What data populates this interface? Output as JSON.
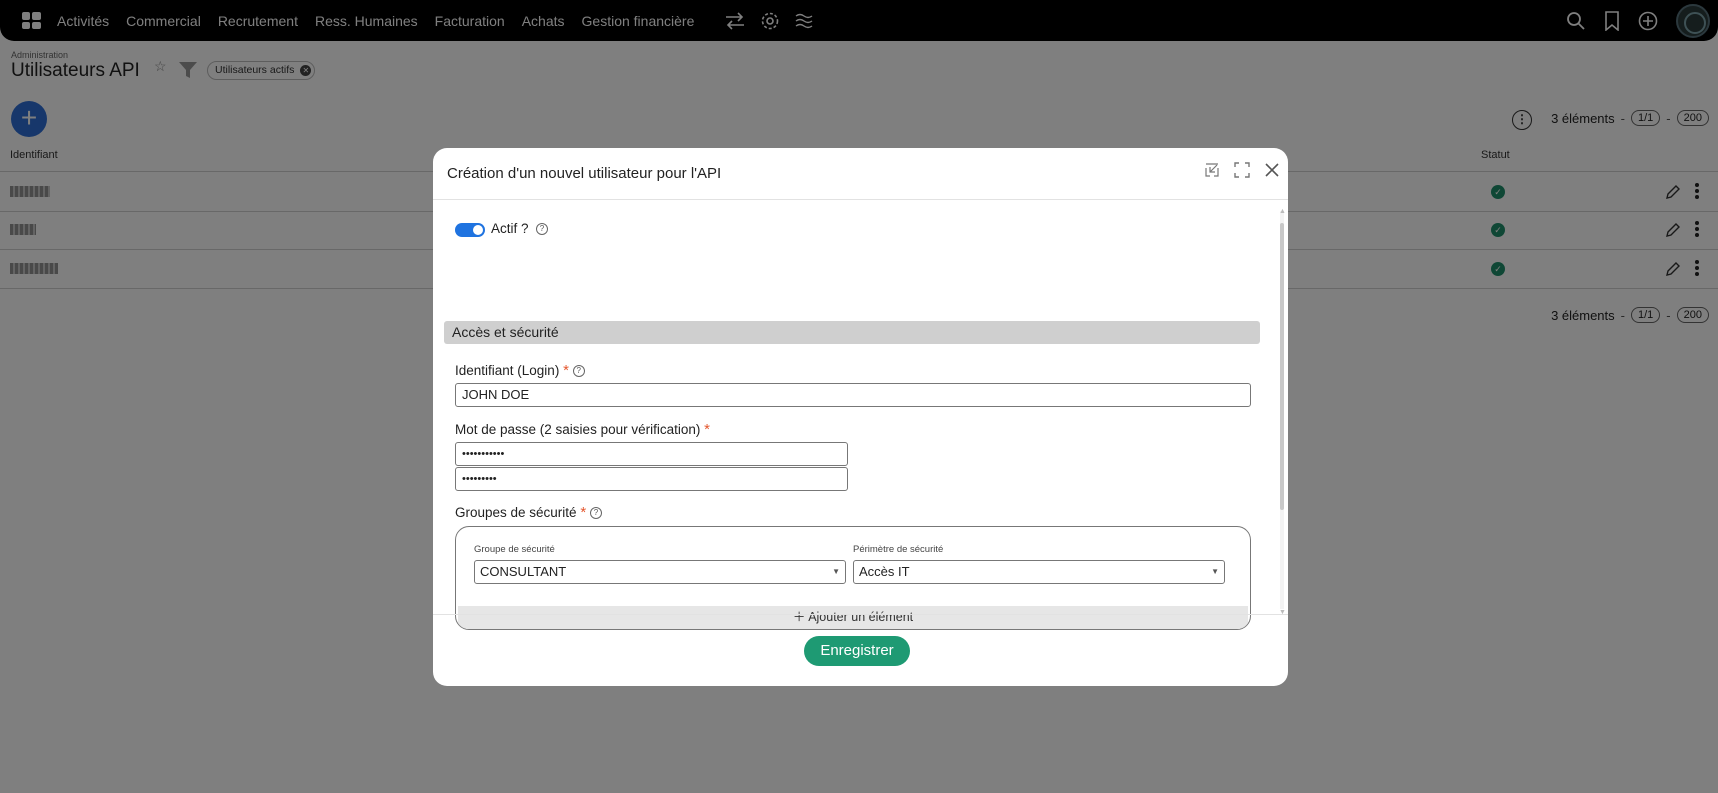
{
  "nav": {
    "items": [
      "Activités",
      "Commercial",
      "Recrutement",
      "Ress. Humaines",
      "Facturation",
      "Achats",
      "Gestion financière"
    ]
  },
  "page": {
    "breadcrumb": "Administration",
    "title": "Utilisateurs API",
    "filter_chip": "Utilisateurs actifs"
  },
  "pager": {
    "count": "3 éléments",
    "sep": "-",
    "page": "1/1",
    "size": "200"
  },
  "table": {
    "columns": [
      "Identifiant",
      "Statut"
    ],
    "rows": [
      {
        "status": "active"
      },
      {
        "status": "active"
      },
      {
        "status": "active"
      }
    ]
  },
  "modal": {
    "title": "Création d'un nouvel utilisateur pour l'API",
    "active_label": "Actif ?",
    "active": true,
    "section_title": "Accès et sécurité",
    "login_label": "Identifiant (Login)",
    "login_value": "JOHN DOE",
    "password_label": "Mot de passe (2 saisies pour vérification)",
    "password_1": "•••••••••••",
    "password_2": "•••••••••",
    "groups_label": "Groupes de sécurité",
    "group_col_label": "Groupe de sécurité",
    "perimeter_col_label": "Périmètre de sécurité",
    "group_value": "CONSULTANT",
    "perimeter_value": "Accès IT",
    "add_element": "Ajouter un élément",
    "save": "Enregistrer",
    "required_mark": "*",
    "help_mark": "?"
  },
  "colors": {
    "accent": "#1f73e0",
    "save": "#1e9a73",
    "required": "#e4572e",
    "status_ok": "#1f8f6a"
  }
}
